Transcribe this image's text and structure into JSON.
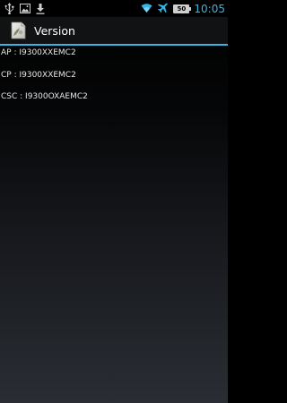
{
  "status_bar": {
    "left_icons": [
      "usb-icon",
      "image-icon",
      "download-icon"
    ],
    "right_icons": [
      "wifi-icon",
      "airplane-icon",
      "battery-icon"
    ],
    "battery_level": "50",
    "time": "10:05",
    "accent_color": "#33b5e5"
  },
  "action_bar": {
    "title": "Version",
    "icon": "app-icon"
  },
  "version_items": [
    {
      "label": "AP : I9300XXEMC2"
    },
    {
      "label": "CP : I9300XXEMC2"
    },
    {
      "label": "CSC : I9300OXAEMC2"
    }
  ]
}
